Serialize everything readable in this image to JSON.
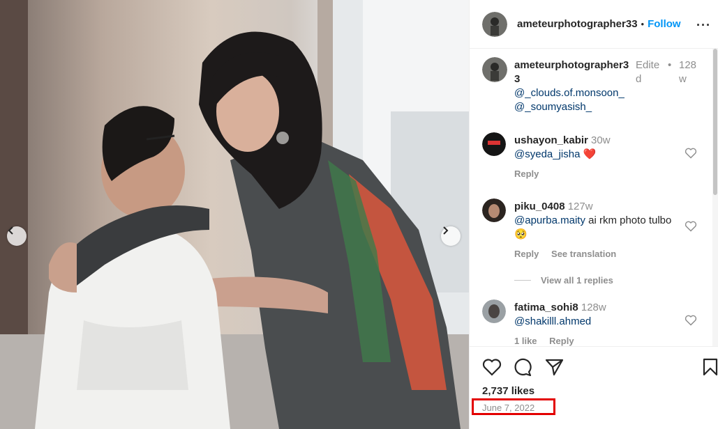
{
  "post": {
    "author": "ameteurphotographer33",
    "follow_label": "Follow",
    "dot": "•",
    "more_label": "···"
  },
  "caption": {
    "user_line1": "ameteurphotographer3",
    "user_line2": "3",
    "edited_line1": "Edite",
    "edited_line2": "d",
    "dot": "•",
    "time_line1": "128",
    "time_line2": "w",
    "mention1": "@_clouds.of.monsoon_",
    "mention2": "@_soumyasish_"
  },
  "comments": [
    {
      "user": "ushayon_kabir",
      "time": "30w",
      "mention": "@syeda_jisha",
      "text": "",
      "emoji": "❤️",
      "reply_label": "Reply",
      "extra_label": ""
    },
    {
      "user": "piku_0408",
      "time": "127w",
      "mention": "@apurba.maity",
      "text": " ai rkm photo tulbo",
      "emoji": "🥺",
      "reply_label": "Reply",
      "extra_label": "See translation"
    },
    {
      "user": "fatima_sohi8",
      "time": "128w",
      "mention": "@shakilll.ahmed",
      "text": "",
      "emoji": "",
      "reply_label": "Reply",
      "likes_label": "1 like"
    }
  ],
  "view_replies_label": "View all 1 replies",
  "likes_text": "2,737 likes",
  "date_text": "June 7, 2022",
  "colors": {
    "accent": "#0095f6",
    "highlight_box": "#e30000",
    "heart": "#ed4956"
  },
  "icons": [
    "chevron-left-icon",
    "chevron-right-icon",
    "heart-icon",
    "comment-icon",
    "share-icon",
    "bookmark-icon",
    "more-icon"
  ]
}
